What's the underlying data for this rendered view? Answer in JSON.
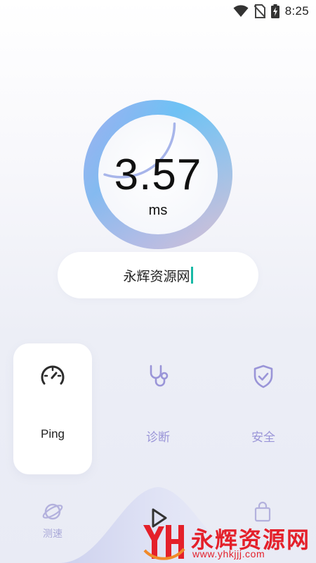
{
  "status_bar": {
    "time": "8:25",
    "icons": [
      "wifi-icon",
      "no-sim-icon",
      "battery-charging-icon"
    ]
  },
  "gauge": {
    "value": "3.57",
    "unit": "ms",
    "progress_fraction": 0.3
  },
  "host_input": {
    "value": "永辉资源网"
  },
  "tools": [
    {
      "label": "Ping",
      "icon": "speedometer-icon",
      "active": true
    },
    {
      "label": "诊断",
      "icon": "stethoscope-icon",
      "active": false
    },
    {
      "label": "安全",
      "icon": "shield-check-icon",
      "active": false
    }
  ],
  "bottom_nav": [
    {
      "label": "测速",
      "icon": "planet-icon"
    },
    {
      "label": "",
      "icon": "play-icon"
    },
    {
      "label": "",
      "icon": "shopping-bag-icon"
    }
  ],
  "watermark": {
    "text": "永辉资源网",
    "url": "www.yhkjjj.com"
  },
  "colors": {
    "accent": "#9a95d8",
    "watermark_red": "#e4202a",
    "caret": "#18b9a5"
  }
}
